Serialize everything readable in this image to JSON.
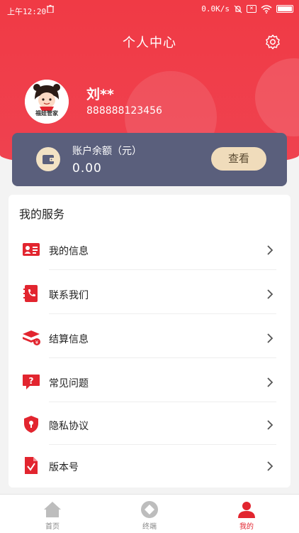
{
  "status_bar": {
    "time": "上午12:20",
    "network_speed": "0.0K/s"
  },
  "header": {
    "title": "个人中心"
  },
  "user": {
    "name": "刘**",
    "phone": "888888123456",
    "avatar_text": "福娃管家"
  },
  "balance": {
    "label": "账户余额（元）",
    "value": "0.00",
    "view_button": "查看"
  },
  "services": {
    "title": "我的服务",
    "items": [
      {
        "label": "我的信息",
        "icon": "id-card-icon"
      },
      {
        "label": "联系我们",
        "icon": "phone-book-icon"
      },
      {
        "label": "结算信息",
        "icon": "settlement-icon"
      },
      {
        "label": "常见问题",
        "icon": "question-bubble-icon"
      },
      {
        "label": "隐私协议",
        "icon": "shield-lock-icon"
      },
      {
        "label": "版本号",
        "icon": "version-doc-icon"
      }
    ]
  },
  "tabbar": {
    "tabs": [
      {
        "label": "首页",
        "icon": "home-icon",
        "active": false
      },
      {
        "label": "终端",
        "icon": "terminal-icon",
        "active": false
      },
      {
        "label": "我的",
        "icon": "profile-icon",
        "active": true
      }
    ]
  },
  "colors": {
    "brand_red": "#ef3b46",
    "card_bg": "#5a5f7c",
    "gold": "#f0dcbb",
    "active_tab": "#e2252f"
  }
}
